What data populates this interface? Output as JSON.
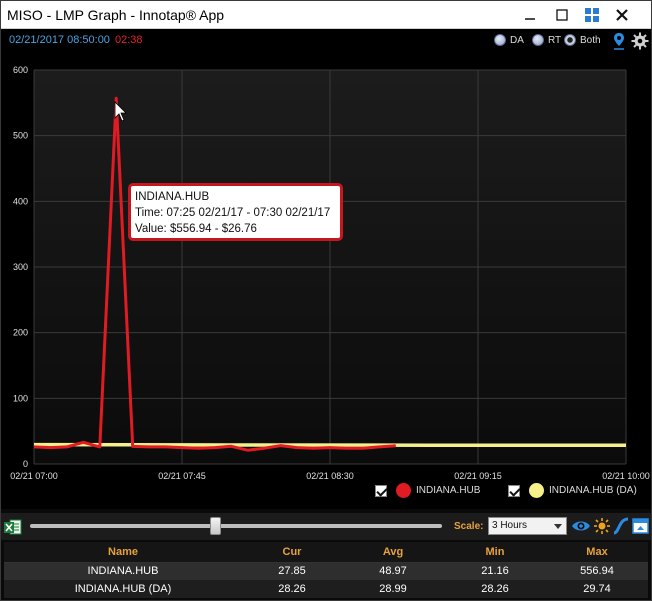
{
  "window": {
    "title": "MISO - LMP Graph - Innotap® App",
    "controls": {
      "minimize_icon": "minimize-icon",
      "maximize_icon": "maximize-icon",
      "tile_icon": "tile-icon",
      "close_icon": "close-icon"
    }
  },
  "header": {
    "date_time": "02/21/2017 08:50:00",
    "countdown": "02:38",
    "mode_options": [
      {
        "label": "DA",
        "selected": false
      },
      {
        "label": "RT",
        "selected": false
      },
      {
        "label": "Both",
        "selected": true
      }
    ],
    "icons": {
      "pin": "map-pin-icon",
      "settings": "gear-icon"
    }
  },
  "tooltip": {
    "title": "INDIANA.HUB",
    "time": "Time: 07:25 02/21/17 - 07:30 02/21/17",
    "value": "Value: $556.94 - $26.76"
  },
  "chart_data": {
    "type": "line",
    "x_ticks": [
      "02/21 07:00",
      "02/21 07:45",
      "02/21 08:30",
      "02/21 09:15",
      "02/21 10:00"
    ],
    "x_range_minutes": [
      0,
      180
    ],
    "y_ticks": [
      "600",
      "500",
      "400",
      "300",
      "200",
      "100",
      "0"
    ],
    "ylim": [
      0,
      600
    ],
    "grid": true,
    "series": [
      {
        "name": "INDIANA.HUB",
        "color": "#e01b24",
        "x": [
          "07:00",
          "07:05",
          "07:10",
          "07:15",
          "07:20",
          "07:25",
          "07:30",
          "07:35",
          "07:40",
          "07:45",
          "07:50",
          "07:55",
          "08:00",
          "08:05",
          "08:10",
          "08:15",
          "08:20",
          "08:25",
          "08:30",
          "08:35",
          "08:40",
          "08:45",
          "08:50"
        ],
        "values": [
          26,
          25,
          26,
          33,
          26,
          556.94,
          26.76,
          26,
          26,
          25,
          24,
          25,
          27,
          21,
          24,
          28,
          25,
          24,
          25,
          24,
          24,
          26,
          27.85
        ]
      },
      {
        "name": "INDIANA.HUB (DA)",
        "color": "#f5f08a",
        "x": [
          "07:00",
          "08:00",
          "09:00",
          "10:00"
        ],
        "values": [
          29.5,
          29.0,
          28.6,
          28.5
        ]
      }
    ],
    "legend": [
      {
        "label": "INDIANA.HUB",
        "color": "#e01b24",
        "checked": true
      },
      {
        "label": "INDIANA.HUB (DA)",
        "color": "#f5f08a",
        "checked": true
      }
    ]
  },
  "toolbar": {
    "excel_icon": "excel-export-icon",
    "slider_level": 0.45,
    "scale_label": "Scale:",
    "scale_value": "3 Hours",
    "icons": [
      "eye-icon",
      "sun-icon",
      "curve-icon",
      "panel-toggle-icon"
    ]
  },
  "table": {
    "headers": [
      "Name",
      "Cur",
      "Avg",
      "Min",
      "Max"
    ],
    "rows": [
      [
        "INDIANA.HUB",
        "27.85",
        "48.97",
        "21.16",
        "556.94"
      ],
      [
        "INDIANA.HUB (DA)",
        "28.26",
        "28.99",
        "28.26",
        "29.74"
      ]
    ]
  }
}
